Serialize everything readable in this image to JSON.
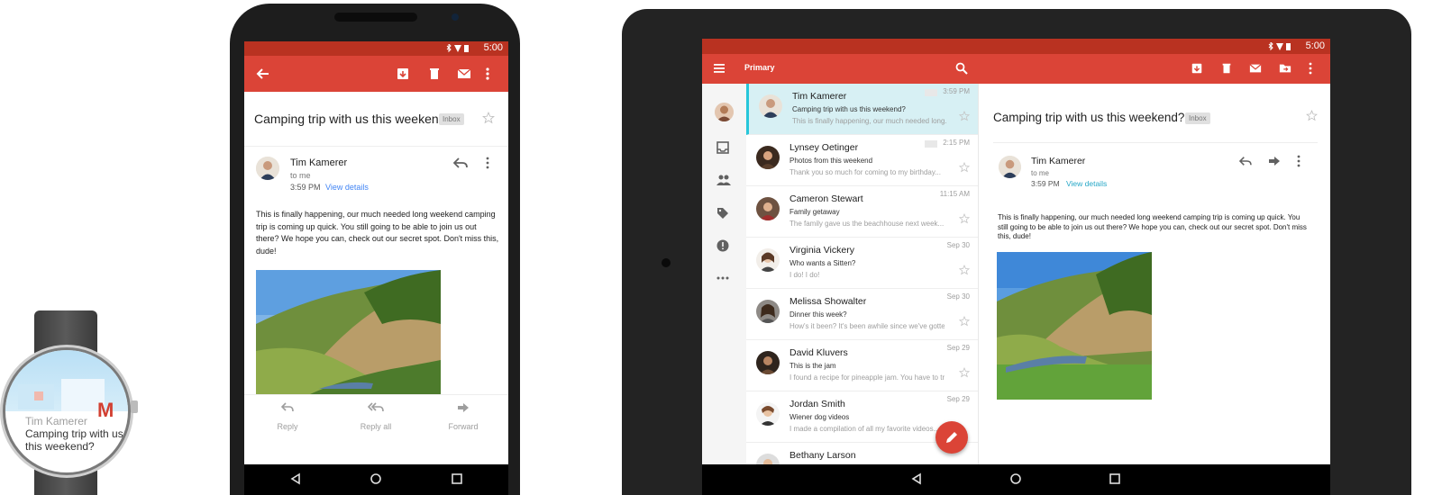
{
  "colors": {
    "gmail_red": "#db4437",
    "status_red": "#b93221",
    "teal_accent": "#26c6da",
    "link_blue": "#4285f4"
  },
  "watch": {
    "sender": "Tim Kamerer",
    "subject": "Camping trip with us this weekend?",
    "logo_icon": "gmail-m-icon"
  },
  "phone": {
    "status_time": "5:00",
    "toolbar_icons": [
      "back-arrow-icon",
      "archive-icon",
      "delete-icon",
      "mark-unread-icon",
      "more-vert-icon"
    ],
    "subject": "Camping trip with us this weeken...",
    "label_chip": "Inbox",
    "sender": "Tim Kamerer",
    "to": "to me",
    "time": "3:59 PM",
    "view_details": "View details",
    "body": "This is finally happening, our much needed long weekend camping trip is coming up quick. You still going to be able to join us out there? We hope you can, check out our secret spot. Don't miss this, dude!",
    "actions": {
      "reply": "Reply",
      "reply_all": "Reply all",
      "forward": "Forward"
    }
  },
  "tablet": {
    "status_time": "5:00",
    "folder": "Primary",
    "toolbar_icons": [
      "menu-icon",
      "search-icon",
      "archive-icon",
      "delete-icon",
      "mark-unread-icon",
      "move-to-folder-icon",
      "more-vert-icon"
    ],
    "rail_icons": [
      "account-avatar",
      "inbox-icon",
      "people-icon",
      "label-icon",
      "spam-icon",
      "more-horiz-icon"
    ],
    "threads": [
      {
        "name": "Tim Kamerer",
        "subject": "Camping trip with us this weekend?",
        "preview": "This is finally happening, our much needed long...",
        "time": "3:59 PM",
        "selected": true
      },
      {
        "name": "Lynsey Oetinger",
        "subject": "Photos from this weekend",
        "preview": "Thank you so much for coming to my birthday...",
        "time": "2:15 PM",
        "selected": false
      },
      {
        "name": "Cameron Stewart",
        "subject": "Family getaway",
        "preview": "The family gave us the beachhouse next week...",
        "time": "11:15 AM",
        "selected": false
      },
      {
        "name": "Virginia Vickery",
        "subject": "Who wants a Sitten?",
        "preview": "I do! I do!",
        "time": "Sep 30",
        "selected": false
      },
      {
        "name": "Melissa Showalter",
        "subject": "Dinner this week?",
        "preview": "How's it been? It's been awhile since we've gotten...",
        "time": "Sep 30",
        "selected": false
      },
      {
        "name": "David Kluvers",
        "subject": "This is the jam",
        "preview": "I found a recipe for pineapple jam. You have to try...",
        "time": "Sep 29",
        "selected": false
      },
      {
        "name": "Jordan Smith",
        "subject": "Wiener dog videos",
        "preview": "I made a compilation of all my favorite videos...",
        "time": "Sep 29",
        "selected": false
      },
      {
        "name": "Bethany Larson",
        "subject": "",
        "preview": "",
        "time": "",
        "selected": false
      }
    ],
    "reading": {
      "subject": "Camping trip with us this weekend?",
      "label_chip": "Inbox",
      "sender": "Tim Kamerer",
      "to": "to me",
      "time": "3:59 PM",
      "view_details": "View details",
      "body": "This is finally happening, our much needed long weekend camping trip is coming up quick. You still going to be able to join us out there? We hope you can, check out our secret spot. Don't miss this, dude!"
    }
  }
}
